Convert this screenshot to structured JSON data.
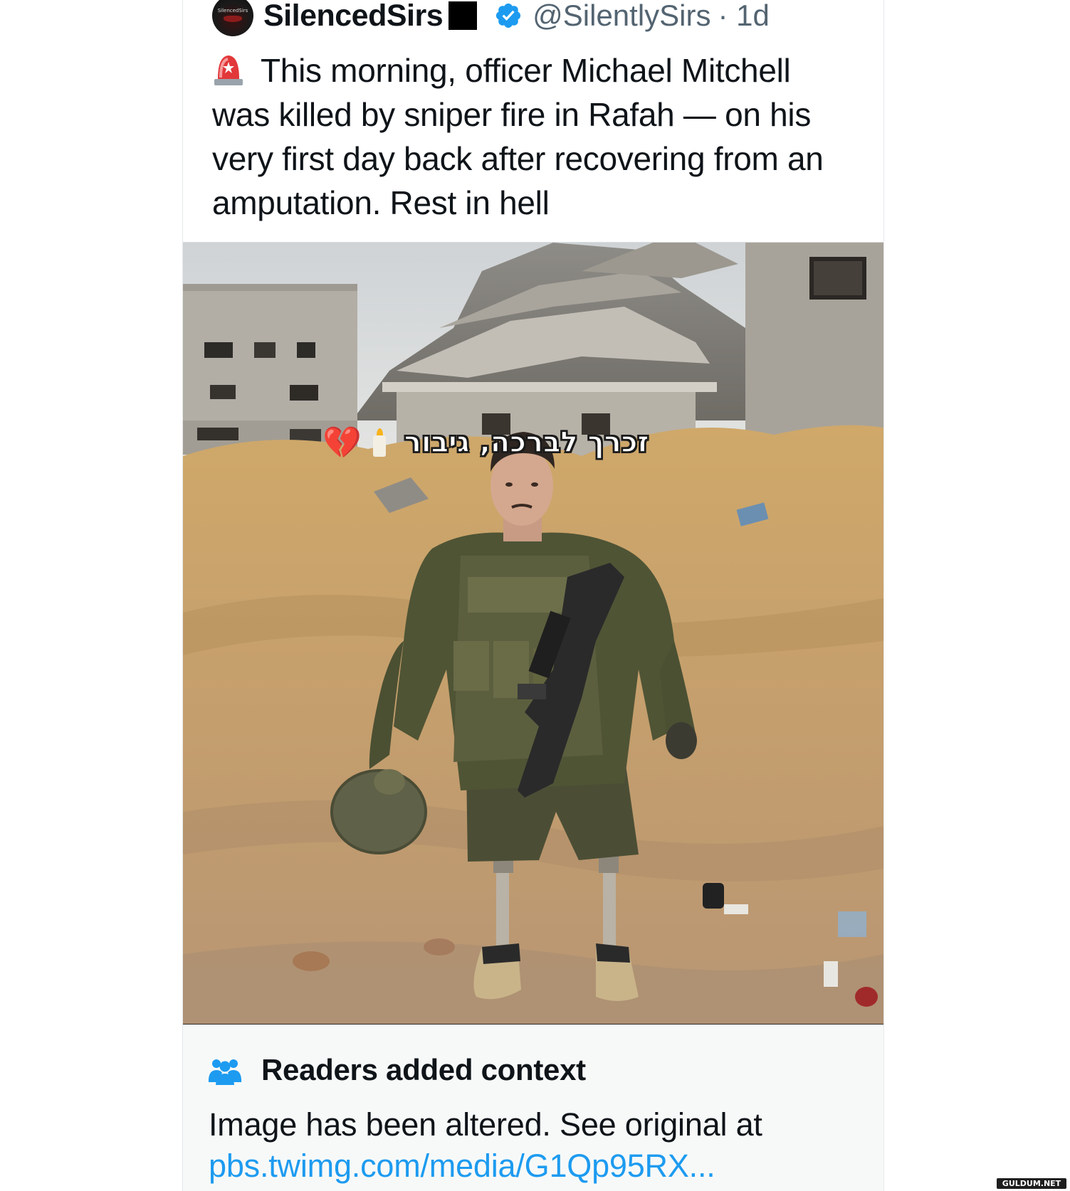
{
  "tweet": {
    "avatar_text": "SilencedSirs",
    "display_name": "SilencedSirs",
    "handle": "@SilentlySirs",
    "time": "· 1d",
    "text": "This morning, officer Michael Mitchell was killed by sniper fire in Rafah — on his very first day back after recovering from an amputation. Rest in hell",
    "icons": {
      "verified": "verified-badge-icon",
      "emoji": "police-siren-icon"
    }
  },
  "media": {
    "overlay_heart": "💔",
    "overlay_text": "זכרך לברכה, גיבור"
  },
  "community_note": {
    "title": "Readers added context",
    "body": "Image has been altered. See original at",
    "link": "pbs.twimg.com/media/G1Qp95RX..."
  },
  "watermark": "GULDUM.NET",
  "colors": {
    "link": "#1d9bf0",
    "verified": "#1d9bf0",
    "secondary_text": "#536471",
    "note_bg": "#f7f9f9"
  }
}
